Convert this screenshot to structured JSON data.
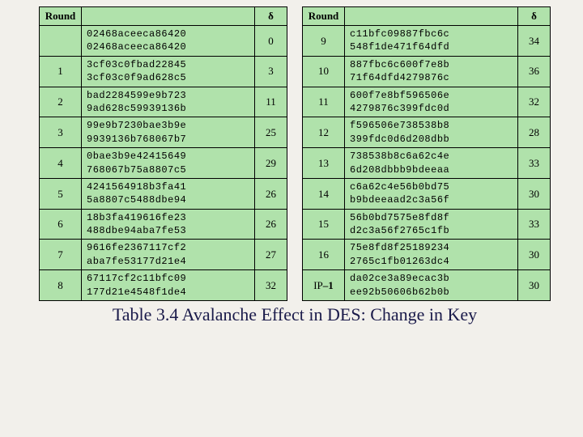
{
  "headers": {
    "round": "Round",
    "delta": "δ"
  },
  "caption": "Table 3.4  Avalanche Effect in DES: Change in Key",
  "ip_inverse_label": "IP–1",
  "left": [
    {
      "round": "",
      "line1": "02468aceeca86420",
      "line2": "02468aceeca86420",
      "delta": "0"
    },
    {
      "round": "1",
      "line1": "3cf03c0fbad22845",
      "line2": "3cf03c0f9ad628c5",
      "delta": "3"
    },
    {
      "round": "2",
      "line1": "bad2284599e9b723",
      "line2": "9ad628c59939136b",
      "delta": "11"
    },
    {
      "round": "3",
      "line1": "99e9b7230bae3b9e",
      "line2": "9939136b768067b7",
      "delta": "25"
    },
    {
      "round": "4",
      "line1": "0bae3b9e42415649",
      "line2": "768067b75a8807c5",
      "delta": "29"
    },
    {
      "round": "5",
      "line1": "42415649l8b3fa41",
      "line1_actual": "4241564918b3fa41",
      "line2": "5a8807c5488dbe94",
      "delta": "26"
    },
    {
      "round": "6",
      "line1": "18b3fa419616fe23",
      "line2": "488dbe94aba7fe53",
      "delta": "26"
    },
    {
      "round": "7",
      "line1": "9616fe2367117cf2",
      "line2": "aba7fe53177d21e4",
      "delta": "27"
    },
    {
      "round": "8",
      "line1": "67117cf2c11bfc09",
      "line2": "177d21e4548f1de4",
      "delta": "32"
    }
  ],
  "right": [
    {
      "round": "9",
      "line1": "c11bfc09887fbc6c",
      "line2": "548f1de471f64dfd",
      "delta": "34"
    },
    {
      "round": "10",
      "line1": "887fbc6c600f7e8b",
      "line2": "71f64dfd4279876c",
      "delta": "36"
    },
    {
      "round": "11",
      "line1": "600f7e8bf596506e",
      "line2": "4279876c399fdc0d",
      "delta": "32"
    },
    {
      "round": "12",
      "line1": "f596506e738538b8",
      "line2": "399fdc0d6d208dbb",
      "delta": "28"
    },
    {
      "round": "13",
      "line1": "738538b8c6a62c4e",
      "line2": "6d208dbbb9bdeeaa",
      "delta": "33"
    },
    {
      "round": "14",
      "line1": "c6a62c4e56b0bd75",
      "line2": "b9bdeeaad2c3a56f",
      "delta": "30"
    },
    {
      "round": "15",
      "line1": "56b0bd7575e8fd8f",
      "line2": "d2c3a56f2765c1fb",
      "delta": "33"
    },
    {
      "round": "16",
      "line1": "75e8fd8f25189234",
      "line2": "2765c1fb01263dc4",
      "delta": "30"
    },
    {
      "round": "IP-1",
      "line1": "da02ce3a89ecac3b",
      "line2": "ee92b50606b62b0b",
      "delta": "30"
    }
  ]
}
